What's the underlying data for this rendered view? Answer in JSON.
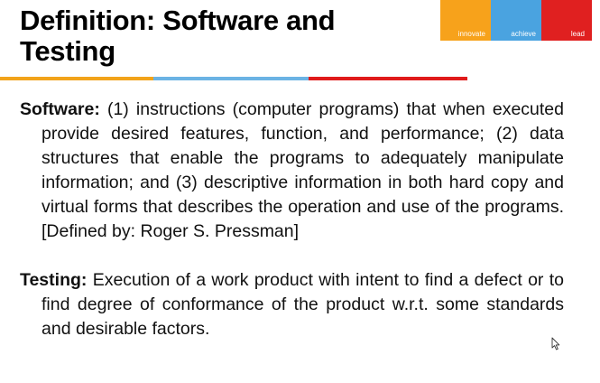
{
  "slide": {
    "title": "Definition: Software  and\nTesting",
    "brand": {
      "labels": [
        "innovate",
        "achieve",
        "lead"
      ],
      "colors": [
        "#f7a21b",
        "#4aa3e0",
        "#e02020"
      ]
    },
    "rule_colors": [
      "#f2a31a",
      "#6bb3e4",
      "#e01b1b"
    ],
    "software": {
      "term": "Software:",
      "text": " (1) instructions (computer programs) that when executed provide desired features, function, and performance; (2) data structures that enable the programs to adequately manipulate information; and (3) descriptive information in both hard copy and virtual forms that describes the operation and use of the programs.  [Defined by: Roger S. Pressman]"
    },
    "testing": {
      "term": "Testing:",
      "text": " Execution of a work product with intent to find a defect or to find degree of conformance of the product w.r.t. some standards and desirable factors."
    }
  }
}
